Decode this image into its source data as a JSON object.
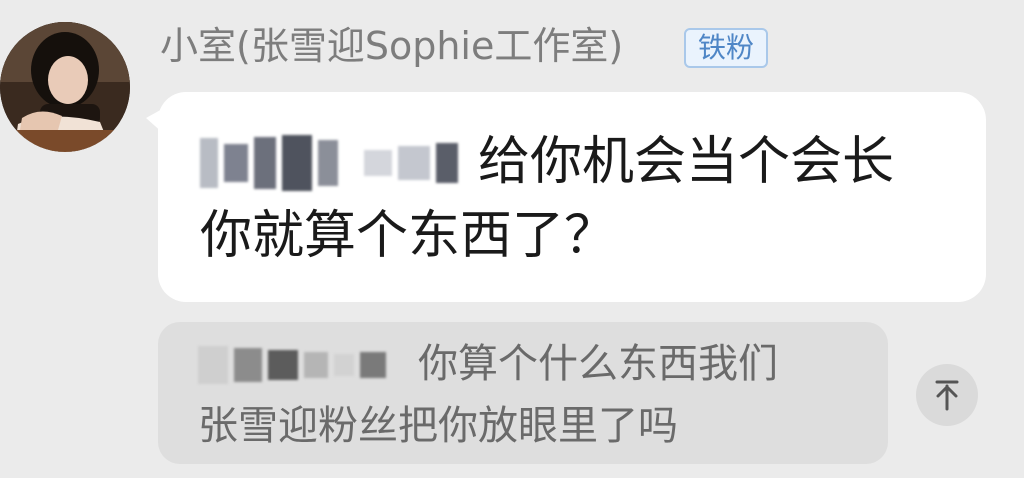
{
  "message": {
    "sender_name": "小室(张雪迎Sophie工作室)",
    "badge": "铁粉",
    "text_line1": "给你机会当个会长",
    "text_line2": "你就算个东西了？"
  },
  "quoted_reply": {
    "text_line1": "你算个什么东西我们",
    "text_line2": "张雪迎粉丝把你放眼里了吗"
  },
  "icons": {
    "avatar": "profile-photo",
    "scroll_top": "arrow-up-to-top-icon"
  },
  "colors": {
    "background": "#ebebeb",
    "bubble": "#ffffff",
    "quote_bubble": "#dedede",
    "badge_text": "#4f86c6",
    "badge_border": "#a9c8ea",
    "sender_name": "#7d7d7d"
  }
}
